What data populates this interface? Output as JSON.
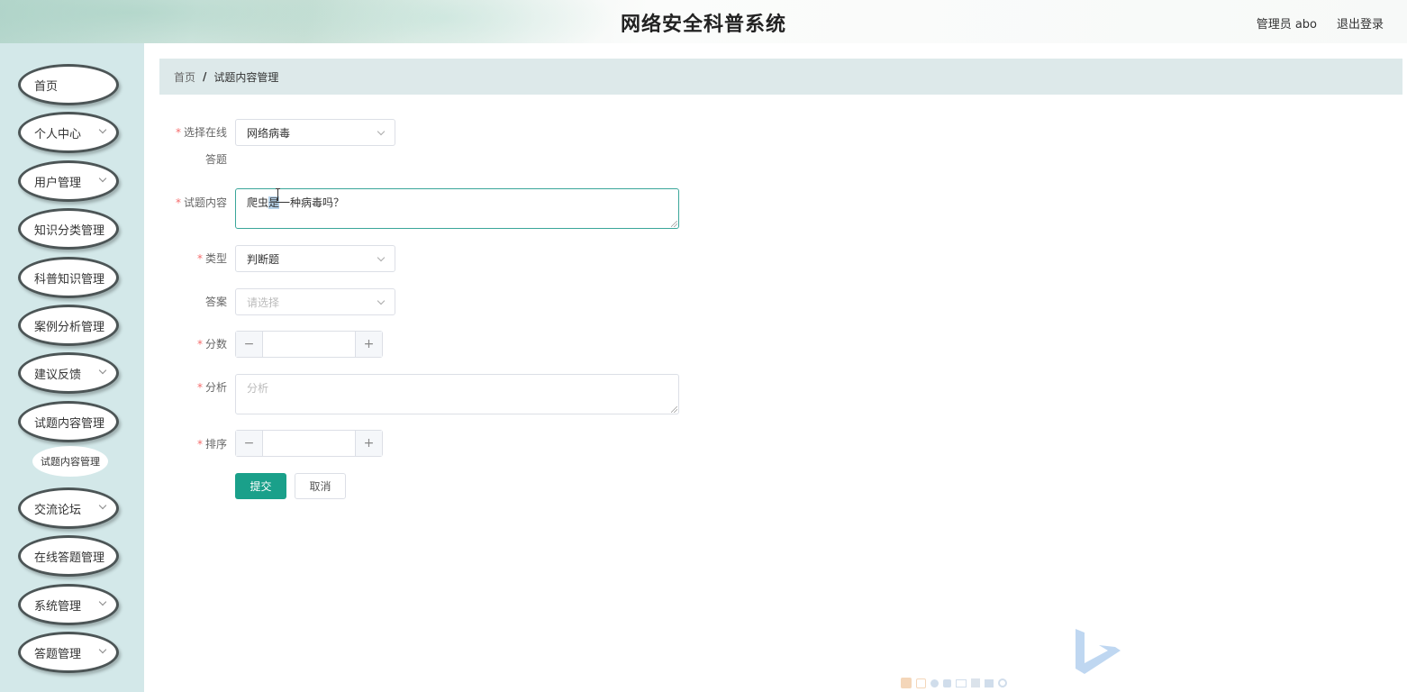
{
  "header": {
    "site_title": "网络安全科普系统",
    "user_info": "管理员 abo",
    "logout_label": "退出登录"
  },
  "sidebar": {
    "items": [
      {
        "label": "首页",
        "has_arrow": false
      },
      {
        "label": "个人中心",
        "has_arrow": true
      },
      {
        "label": "用户管理",
        "has_arrow": true
      },
      {
        "label": "知识分类管理",
        "has_arrow": false
      },
      {
        "label": "科普知识管理",
        "has_arrow": false
      },
      {
        "label": "案例分析管理",
        "has_arrow": false
      },
      {
        "label": "建议反馈",
        "has_arrow": true
      },
      {
        "label": "试题内容管理",
        "has_arrow": false
      },
      {
        "label": "交流论坛",
        "has_arrow": true
      },
      {
        "label": "在线答题管理",
        "has_arrow": false
      },
      {
        "label": "系统管理",
        "has_arrow": true
      },
      {
        "label": "答题管理",
        "has_arrow": true
      }
    ],
    "submenu": {
      "label": "试题内容管理"
    }
  },
  "breadcrumb": {
    "home": "首页",
    "separator": "/",
    "current": "试题内容管理"
  },
  "form": {
    "exam": {
      "required_mark": "*",
      "label_line1": "选择在线",
      "label_line2": "答题",
      "value": "网络病毒"
    },
    "content": {
      "required_mark": "*",
      "label": "试题内容",
      "value_before": "爬虫",
      "value_selected": "是",
      "value_after": "一种病毒吗？"
    },
    "type": {
      "required_mark": "*",
      "label": "类型",
      "value": "判断题"
    },
    "answer": {
      "label": "答案",
      "placeholder": "请选择"
    },
    "score": {
      "required_mark": "*",
      "label": "分数",
      "minus": "−",
      "plus": "+"
    },
    "analysis": {
      "required_mark": "*",
      "label": "分析",
      "placeholder": "分析"
    },
    "order": {
      "required_mark": "*",
      "label": "排序",
      "minus": "−",
      "plus": "+"
    },
    "submit_label": "提交",
    "cancel_label": "取消"
  },
  "colors": {
    "primary": "#1aa08a",
    "sidebar_bg": "#d3e8e9",
    "breadcrumb_bg": "#dde9ea",
    "required": "#f56c6c",
    "menu_border": "#4c5556"
  }
}
